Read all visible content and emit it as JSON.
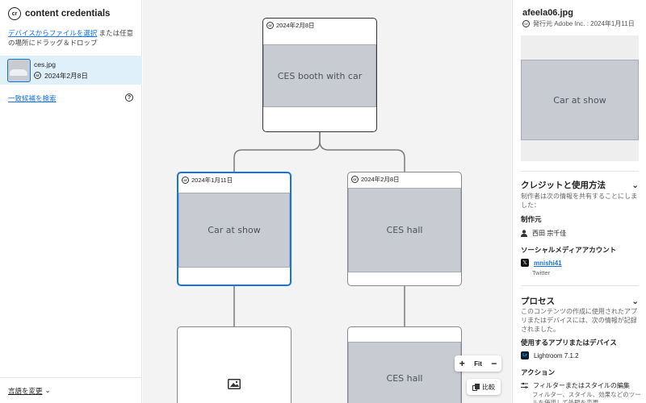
{
  "brand": {
    "name": "content credentials",
    "logo": "cr"
  },
  "upload": {
    "link": "デバイスからファイルを選択",
    "rest": " または任意の場所にドラッグ＆ドロップ"
  },
  "file": {
    "name": "ces.jpg",
    "date": "2024年2月8日"
  },
  "search_match": "一致候補を検索",
  "language": "言語を変更",
  "cr_badge": "cr",
  "canvas": {
    "root_card": {
      "date": "2024年2月8日"
    },
    "child_left": {
      "date": "2024年1月11日"
    },
    "child_right": {
      "date": "2024年2月8日"
    }
  },
  "zoom": {
    "plus": "+",
    "fit": "Fit",
    "minus": "−"
  },
  "compare": "比較",
  "right": {
    "title": "afeela06.jpg",
    "issuer": "発行元 Adobe Inc. : 2024年1月11日",
    "credit_section": "クレジットと使用方法",
    "credit_desc": "制作者は次の情報を共有することにしました：",
    "producer_label": "制作元",
    "producer_name": "西田 宗千佳",
    "social_label": "ソーシャルメディアアカウント",
    "social_handle": "mnishi41",
    "social_platform": "Twitter",
    "process_section": "プロセス",
    "process_desc": "このコンテンツの作成に使用されたアプリまたはデバイスには、次の情報が記録されました。",
    "apps_label": "使用するアプリまたはデバイス",
    "app_name": "Lightroom 7.1.2",
    "app_icon": "Lr",
    "actions_label": "アクション",
    "action_name": "フィルターまたはスタイルの編集",
    "action_desc": "フィルター、スタイル、効果などのツールを使用して外観を変更"
  },
  "icons": {
    "help": "?",
    "x": "𝕏",
    "chevron": "⌄"
  },
  "colors": {
    "accent": "#1473e6",
    "selected_bg": "#dff0fb"
  }
}
